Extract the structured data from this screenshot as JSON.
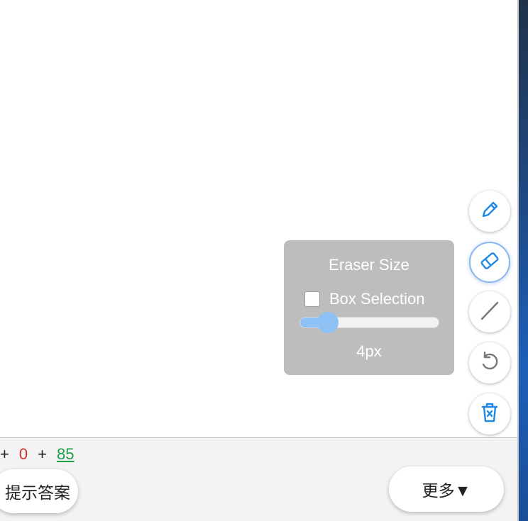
{
  "equation": {
    "plus1": "+",
    "value_red": "0",
    "plus2": "+",
    "value_green": "85"
  },
  "buttons": {
    "hint_label": "提示答案",
    "more_label": "更多▼"
  },
  "eraser_panel": {
    "title": "Eraser Size",
    "box_selection_label": "Box Selection",
    "box_selection_checked": false,
    "slider_fraction": 0.2,
    "size_readout": "4px"
  },
  "tools": [
    {
      "name": "pencil-icon",
      "active": false
    },
    {
      "name": "eraser-icon",
      "active": true
    },
    {
      "name": "line-icon",
      "active": false
    },
    {
      "name": "undo-icon",
      "active": false
    },
    {
      "name": "trash-icon",
      "active": false
    }
  ],
  "colors": {
    "accent_blue": "#1e88e5",
    "panel_gray": "#bdbdbd",
    "slider_blue": "#8ec1f5",
    "equation_red": "#d32f2f",
    "equation_green": "#1f9d46"
  }
}
